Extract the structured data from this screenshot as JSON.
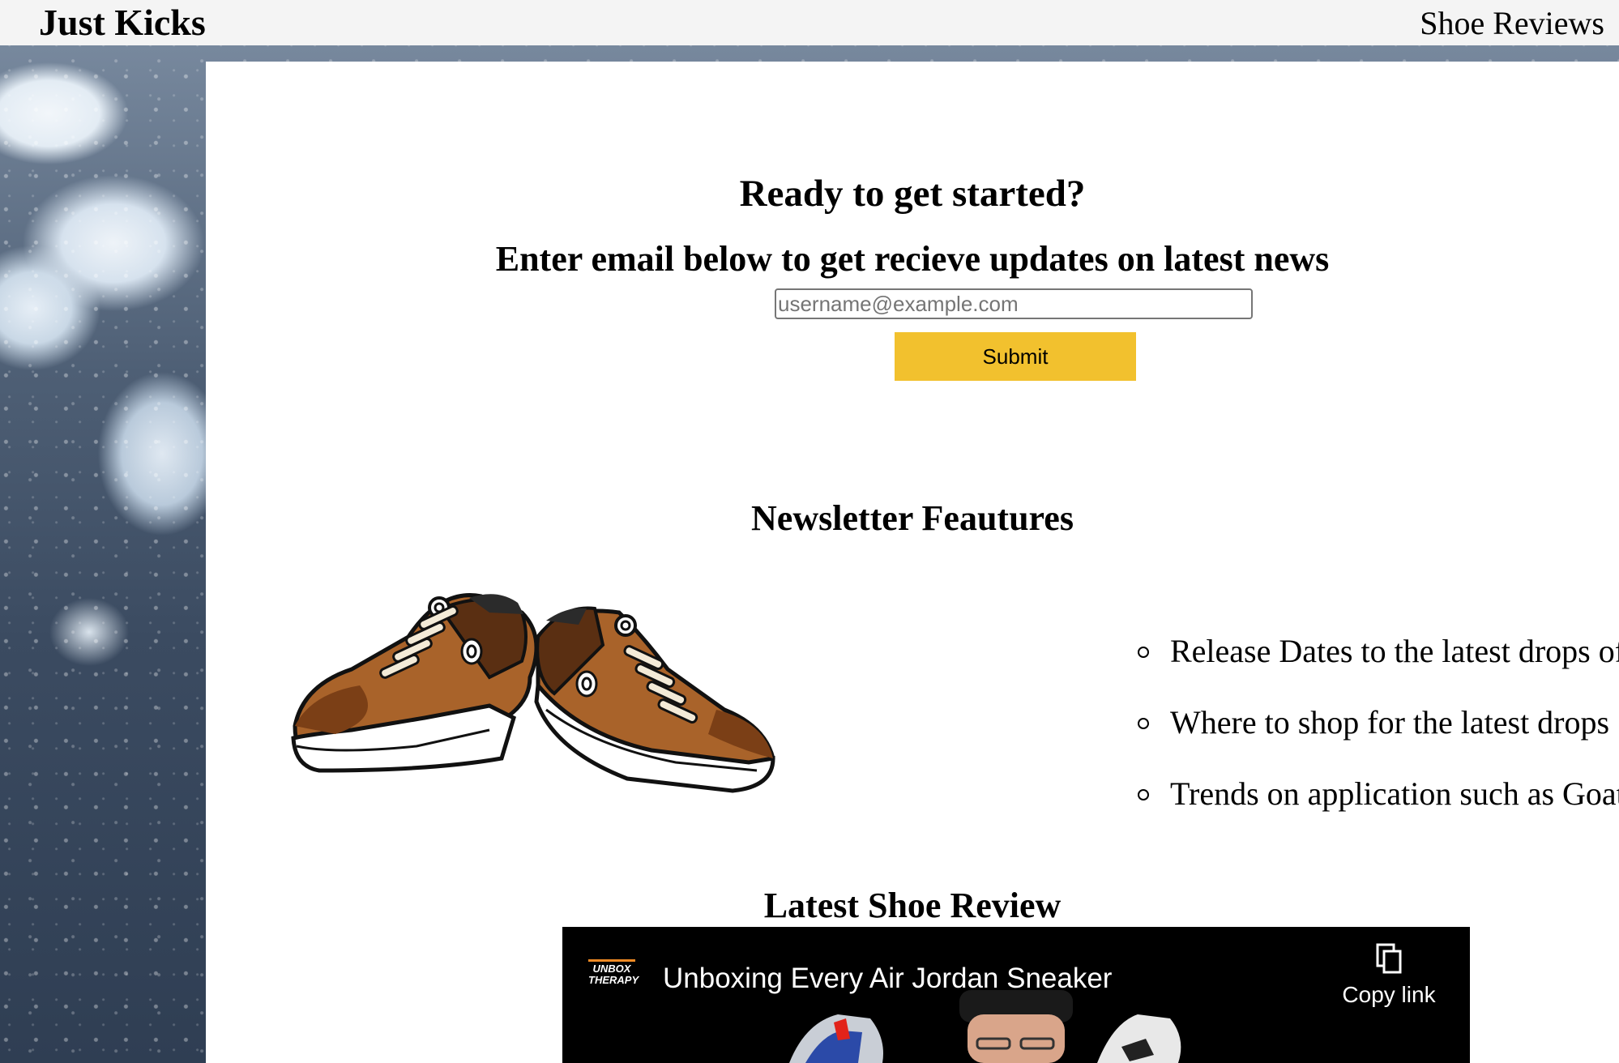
{
  "header": {
    "brand": "Just Kicks",
    "nav_link": "Shoe Reviews"
  },
  "signup": {
    "heading": "Ready to get started?",
    "subheading": "Enter email below to get recieve updates on latest news",
    "email_placeholder": "username@example.com",
    "submit_label": "Submit",
    "submit_color": "#f2c12e"
  },
  "newsletter": {
    "heading": "Newsletter Feautures",
    "features": [
      "Release Dates to the latest drops of",
      "Where to shop for the latest drops",
      "Trends on application such as Goat"
    ]
  },
  "review": {
    "heading": "Latest Shoe Review",
    "channel_logo": "UNBOX THERAPY",
    "video_title": "Unboxing Every Air Jordan Sneaker",
    "copy_link_label": "Copy link"
  }
}
